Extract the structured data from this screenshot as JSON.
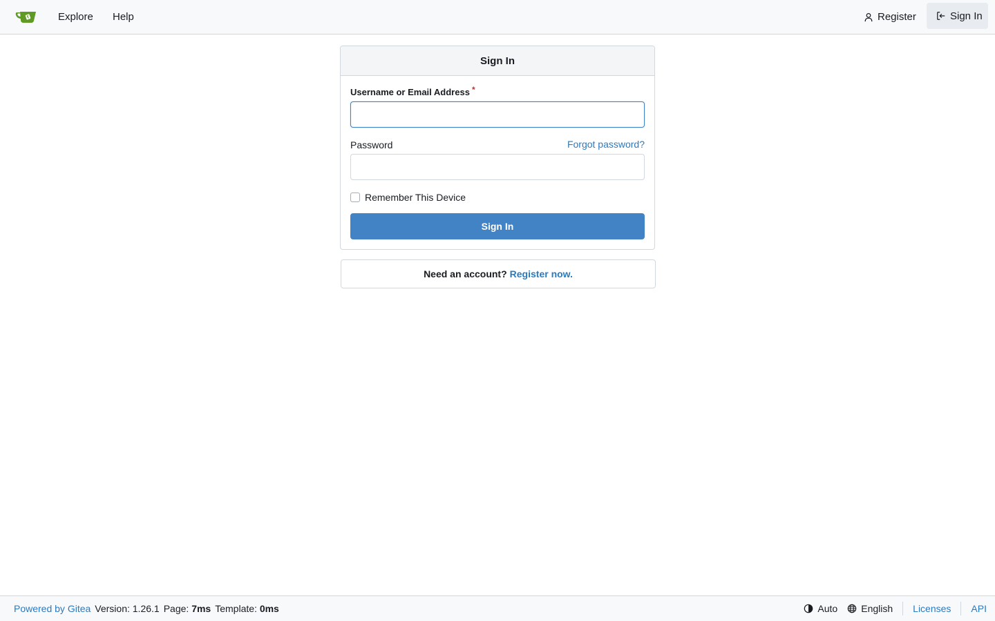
{
  "navbar": {
    "explore_label": "Explore",
    "help_label": "Help",
    "register_label": "Register",
    "signin_label": "Sign In"
  },
  "signin": {
    "title": "Sign In",
    "username_label": "Username or Email Address",
    "required_marker": "*",
    "username_value": "",
    "password_label": "Password",
    "forgot_label": "Forgot password?",
    "password_value": "",
    "remember_label": "Remember This Device",
    "submit_label": "Sign In"
  },
  "register_prompt": {
    "text": "Need an account?",
    "link_label": "Register now."
  },
  "footer": {
    "powered_label": "Powered by Gitea",
    "version_text": "Version: 1.26.1",
    "page_label": "Page:",
    "page_time": "7ms",
    "template_label": "Template:",
    "template_time": "0ms",
    "theme_label": "Auto",
    "language_label": "English",
    "licenses_label": "Licenses",
    "api_label": "API"
  },
  "colors": {
    "accent": "#4183c4",
    "link": "#2a7ac0",
    "logo_green": "#609926",
    "required": "#db2828"
  }
}
